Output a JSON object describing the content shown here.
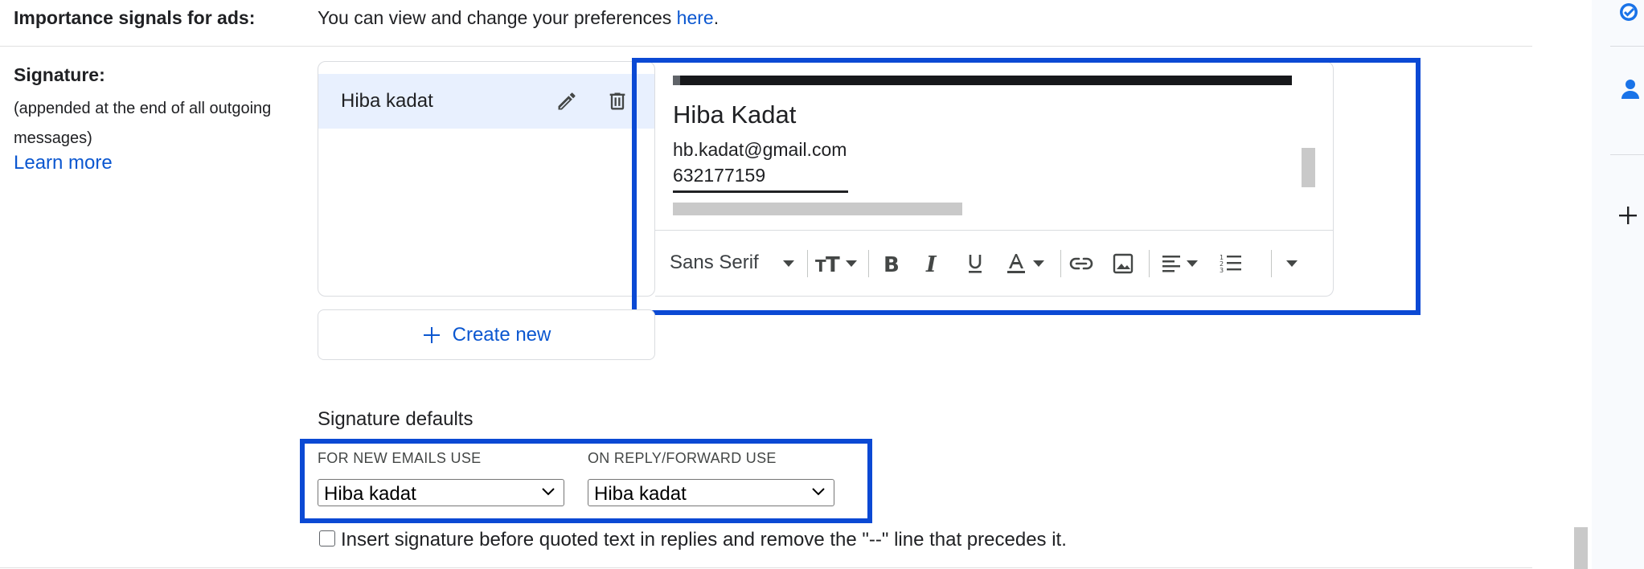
{
  "importance": {
    "label": "Importance signals for ads:",
    "text": "You can view and change your preferences ",
    "link": "here",
    "period": "."
  },
  "signature_section": {
    "label": "Signature:",
    "desc_line1": "(appended at the end of all outgoing",
    "desc_line2": "messages)",
    "learn_more": "Learn more"
  },
  "signature_list": {
    "items": [
      {
        "label": "Hiba kadat"
      }
    ],
    "create_new": "Create new"
  },
  "editor": {
    "name": "Hiba Kadat",
    "email": "hb.kadat@gmail.com",
    "phone": "632177159",
    "toolbar": {
      "font": "Sans Serif",
      "icons": [
        "font-size-icon",
        "bold-icon",
        "italic-icon",
        "underline-icon",
        "text-color-icon",
        "link-icon",
        "image-icon",
        "align-icon",
        "numbered-list-icon",
        "more-options-icon"
      ]
    }
  },
  "defaults": {
    "title": "Signature defaults",
    "new_emails_label": "FOR NEW EMAILS USE",
    "new_emails_value": "Hiba kadat",
    "reply_label": "ON REPLY/FORWARD USE",
    "reply_value": "Hiba kadat"
  },
  "insert_checkbox": {
    "label": "Insert signature before quoted text in replies and remove the \"--\" line that precedes it.",
    "checked": false
  },
  "colors": {
    "accent": "#0b57d0",
    "highlight": "#0b49d4",
    "selected_bg": "#e8f0fe"
  }
}
